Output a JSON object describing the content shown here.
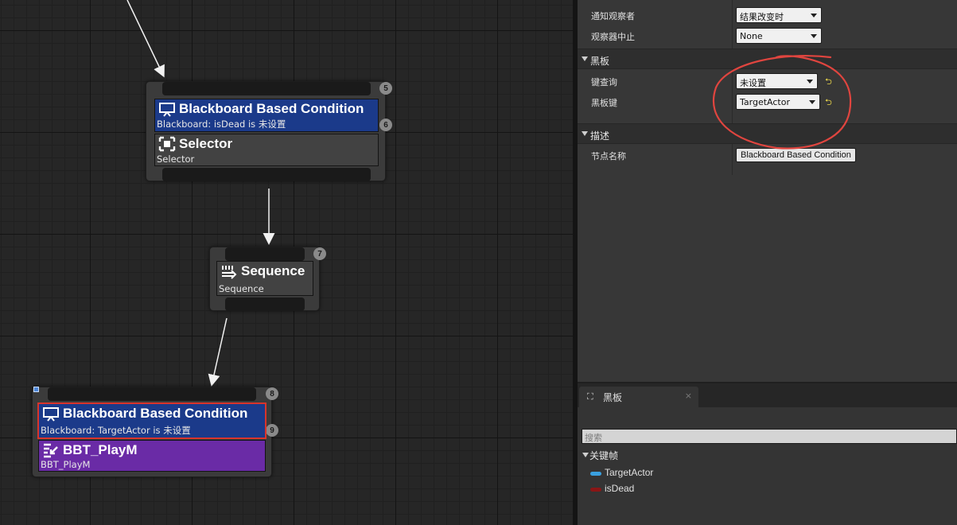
{
  "graph": {
    "nodes": [
      {
        "id": "root-selector",
        "badges": [
          "5",
          "6"
        ],
        "decorator": {
          "title": "Blackboard Based Condition",
          "subtitle": "Blackboard: isDead is 未设置",
          "icon": "blackboard-condition-icon",
          "color": "#1b3a8a"
        },
        "main": {
          "title": "Selector",
          "subtitle": "Selector",
          "icon": "selector-icon"
        }
      },
      {
        "id": "sequence",
        "badges": [
          "7"
        ],
        "main": {
          "title": "Sequence",
          "subtitle": "Sequence",
          "icon": "sequence-icon"
        }
      },
      {
        "id": "task-node",
        "badges": [
          "8",
          "9"
        ],
        "decorator": {
          "title": "Blackboard Based Condition",
          "subtitle": "Blackboard: TargetActor is 未设置",
          "icon": "blackboard-condition-icon",
          "color": "#1b3a8a",
          "selected": true
        },
        "task": {
          "title": "BBT_PlayM",
          "subtitle": "BBT_PlayM",
          "icon": "task-icon",
          "color": "#6a2ba6"
        }
      }
    ]
  },
  "details": {
    "rows_top": [
      {
        "label": "通知观察者",
        "value": "结果改变时"
      },
      {
        "label": "观察器中止",
        "value": "None"
      }
    ],
    "categories": {
      "blackboard": "黑板",
      "description": "描述"
    },
    "blackboard_rows": [
      {
        "label": "键查询",
        "value": "未设置"
      },
      {
        "label": "黑板键",
        "value": "TargetActor"
      }
    ],
    "description_rows": [
      {
        "label": "节点名称",
        "value": "Blackboard Based Condition"
      }
    ],
    "annotation_color": "#e0453f"
  },
  "blackboard_panel": {
    "tab_label": "黑板",
    "tab_close": "×",
    "search_placeholder": "搜索",
    "section_label": "关键帧",
    "keys": [
      {
        "name": "TargetActor",
        "color": "#3aa0e0"
      },
      {
        "name": "isDead",
        "color": "#8a1616"
      }
    ]
  }
}
